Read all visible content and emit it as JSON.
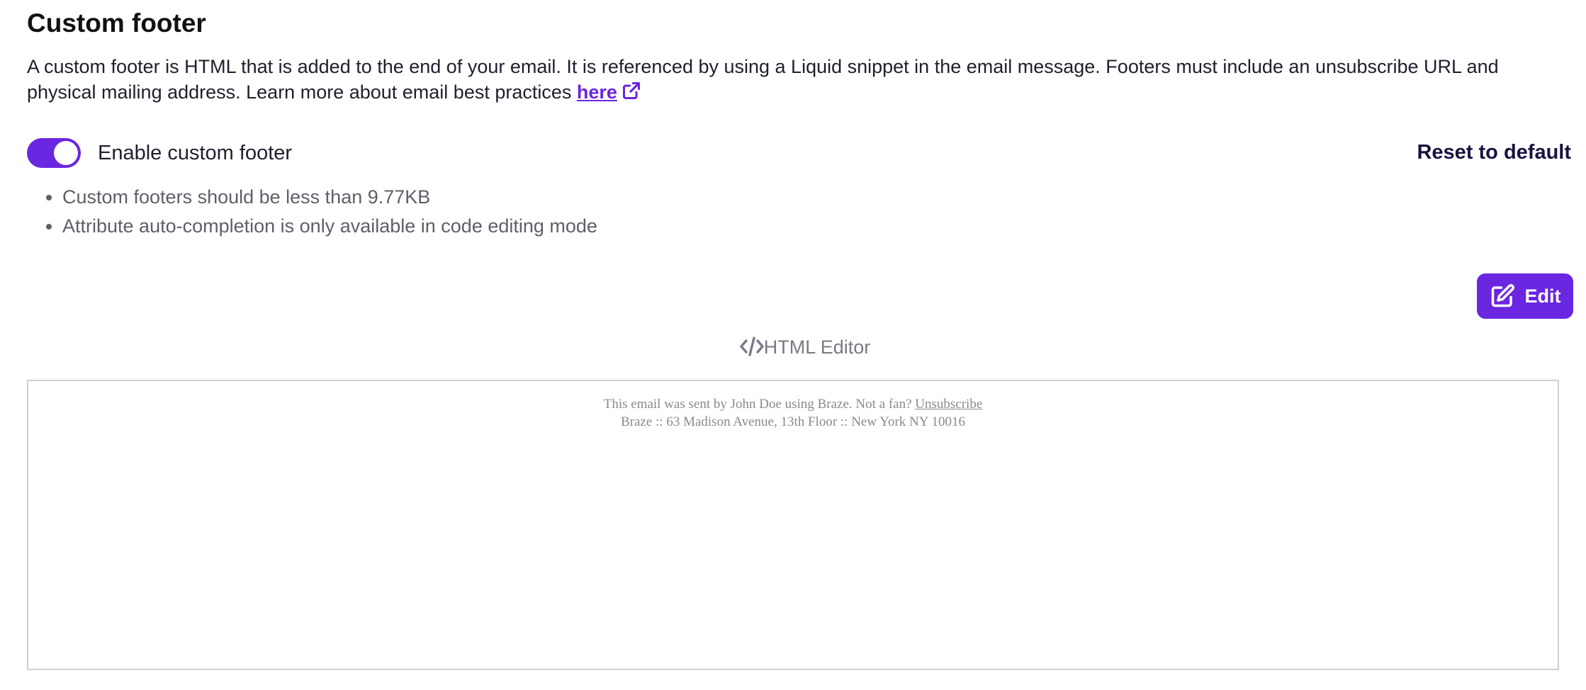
{
  "section": {
    "title": "Custom footer",
    "description": "A custom footer is HTML that is added to the end of your email. It is referenced by using a Liquid snippet in the email message. Footers must include an unsubscribe URL and physical mailing address. Learn more about email best practices",
    "link_label": "here"
  },
  "toggle": {
    "label": "Enable custom footer",
    "enabled": true
  },
  "reset_label": "Reset to default",
  "notes": [
    "Custom footers should be less than 9.77KB",
    "Attribute auto-completion is only available in code editing mode"
  ],
  "edit_button": {
    "label": "Edit"
  },
  "editor": {
    "heading": "HTML Editor"
  },
  "preview": {
    "line1": "This email was sent by John Doe using Braze. Not a fan?",
    "unsubscribe": "Unsubscribe",
    "line2": "Braze :: 63 Madison Avenue, 13th Floor :: New York NY 10016"
  },
  "colors": {
    "accent": "#6a26e0",
    "heading_dark": "#1a1240",
    "muted_text": "#5f5f6b"
  },
  "icons": {
    "external": "external-link-icon",
    "edit": "edit-icon",
    "code": "code-icon"
  }
}
